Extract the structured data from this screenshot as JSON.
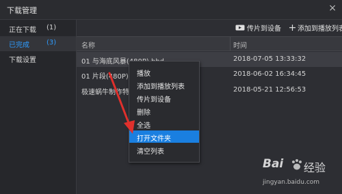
{
  "window": {
    "title": "下载管理",
    "close_icon": "×"
  },
  "sidebar": {
    "items": [
      {
        "label": "正在下载",
        "count": "(1)",
        "active": false
      },
      {
        "label": "已完成",
        "count": "(3)",
        "active": true
      },
      {
        "label": "下载设置",
        "count": "",
        "active": false
      }
    ]
  },
  "toolbar": {
    "cast_label": "传片到设备",
    "add_label": "添加到播放列表"
  },
  "table": {
    "columns": {
      "name": "名称",
      "time": "时间"
    },
    "rows": [
      {
        "name": "01 与海底风暴(480P).bhd",
        "time": "2018-07-05 13:33:32",
        "selected": true
      },
      {
        "name": "01 片段(480P).b",
        "time": "2018-06-02 16:34:45",
        "selected": false
      },
      {
        "name": "极速蜗牛制作特辑",
        "time": "2018-05-21 12:56:53",
        "selected": false
      }
    ]
  },
  "context_menu": {
    "items": [
      "播放",
      "添加到播放列表",
      "传片到设备",
      "删除",
      "全选",
      "打开文件夹",
      "清空列表"
    ],
    "highlighted": "打开文件夹"
  },
  "watermark": {
    "logo": "Bai",
    "logo_suffix": "经验",
    "url": "jingyan.baidu.com"
  },
  "colors": {
    "accent": "#2e9cff",
    "highlight": "#1a7fe0",
    "arrow": "#e0302c"
  }
}
